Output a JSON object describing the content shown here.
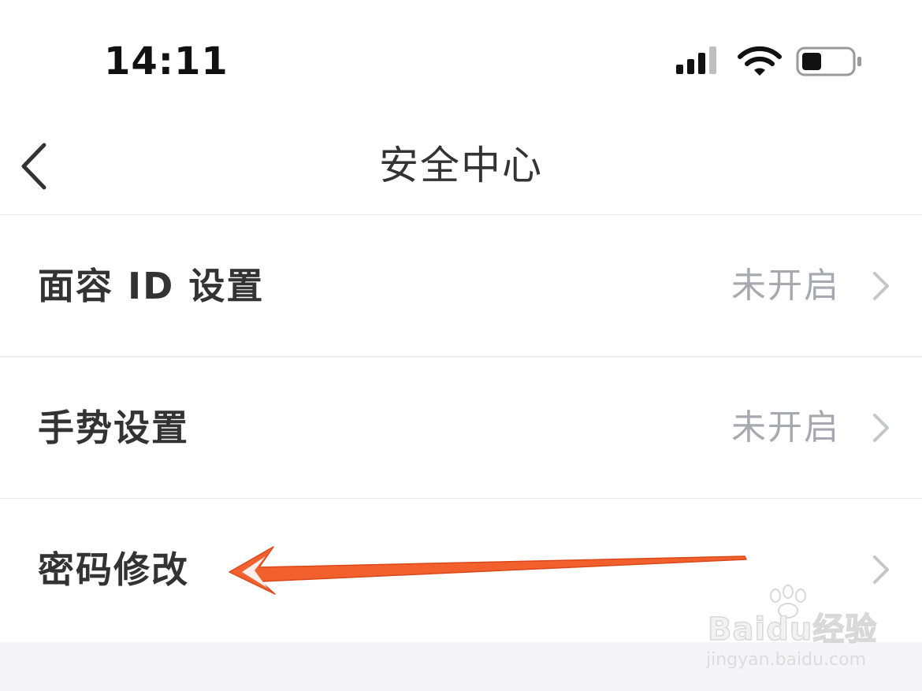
{
  "status_bar": {
    "time": "14:11",
    "icons": [
      "cellular-signal-icon",
      "wifi-icon",
      "battery-icon"
    ]
  },
  "nav": {
    "back_icon": "chevron-left-icon",
    "title": "安全中心"
  },
  "settings": {
    "items": [
      {
        "label": "面容 ID 设置",
        "value": "未开启",
        "chevron": "chevron-right-icon"
      },
      {
        "label": "手势设置",
        "value": "未开启",
        "chevron": "chevron-right-icon"
      },
      {
        "label": "密码修改",
        "value": "",
        "chevron": "chevron-right-icon"
      }
    ]
  },
  "annotation": {
    "type": "arrow",
    "color": "#f2612d",
    "points_to": "密码修改"
  },
  "watermark": {
    "brand": "Baidu经验",
    "url": "jingyan.baidu.com"
  },
  "colors": {
    "text_primary": "#333333",
    "text_secondary": "#a6a9b0",
    "divider": "#e6e6e6",
    "chevron": "#c4c6cc"
  }
}
